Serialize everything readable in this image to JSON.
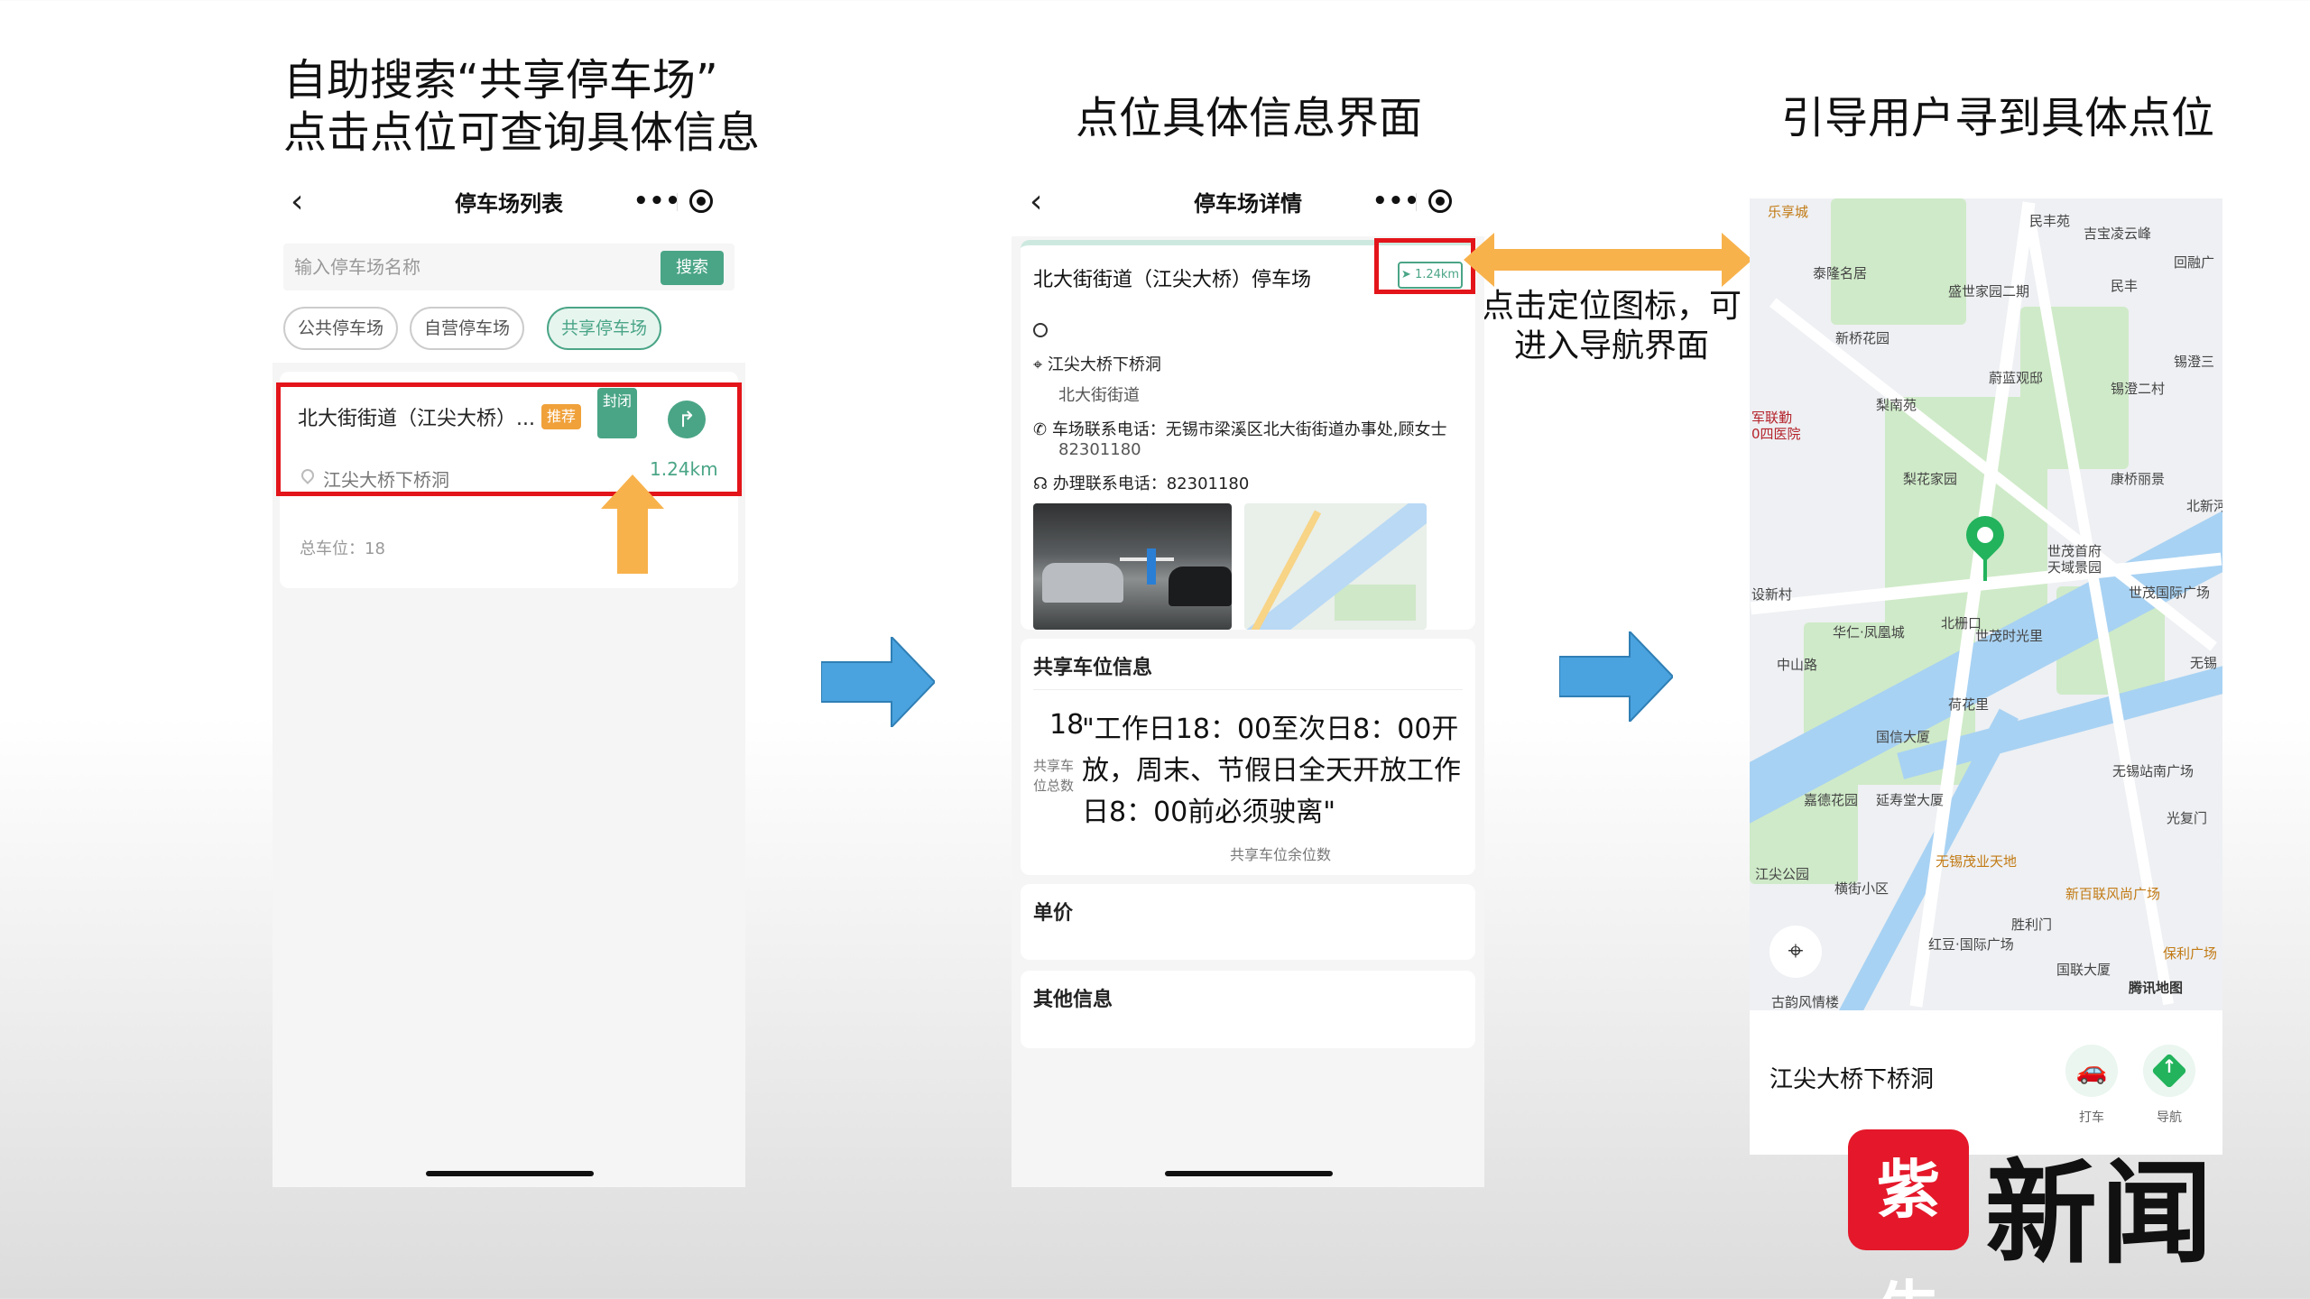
{
  "captions": {
    "step1_line1": "自助搜索“共享停车场”",
    "step1_line2": "点击点位可查询具体信息",
    "step2": "点位具体信息界面",
    "step3": "引导用户寻到具体点位",
    "nav_note": "点击定位图标，可进入导航界面"
  },
  "screen1": {
    "title": "停车场列表",
    "back_icon": "chevron-left-icon",
    "menu_dots": "•••",
    "search_placeholder": "输入停车场名称",
    "search_button": "搜索",
    "filters": [
      "公共停车场",
      "自营停车场",
      "共享停车场"
    ],
    "active_filter": "共享停车场",
    "lot": {
      "name": "北大街街道（江尖大桥）...",
      "badge_recommended": "推荐",
      "badge_closed": "封闭",
      "distance": "1.24km",
      "address": "江尖大桥下桥洞",
      "total_spaces": "总车位：18"
    }
  },
  "screen2": {
    "title": "停车场详情",
    "menu_dots": "•••",
    "lot_name": "北大街街道（江尖大桥）停车场",
    "nav_distance": "1.24km",
    "address": "江尖大桥下桥洞",
    "district": "北大街街道",
    "contact": "车场联系电话：无锡市梁溪区北大街街道办事处,顾女士",
    "contact_phone": "82301180",
    "office_phone": "办理联系电话：82301180",
    "share_section": "共享车位信息",
    "share_count": "18",
    "share_schedule": "\"工作日18：00至次日8：00开放，周末、节假日全天开放工作日8：00前必须驶离\"",
    "share_total_label": "共享车位总数",
    "share_remaining_label": "共享车位余位数",
    "price_section": "单价",
    "other_section": "其他信息"
  },
  "screen3": {
    "destination": "江尖大桥下桥洞",
    "taxi_label": "打车",
    "navigate_label": "导航",
    "map_brand": "腾讯地图",
    "map_labels": [
      "乐享城",
      "民丰苑",
      "吉宝凌云峰",
      "泰隆名居",
      "盛世家园二期",
      "民丰",
      "回融广",
      "新桥花园",
      "锡澄三",
      "蔚蓝观邸",
      "锡澄二村",
      "梨南苑",
      "军联勤",
      "0四医院",
      "梨花家园",
      "康桥丽景",
      "北新河",
      "世茂首府",
      "天域景园",
      "设新村",
      "世茂国际广场",
      "华仁·凤凰城",
      "北栅口",
      "世茂时光里",
      "中山路",
      "荷花里",
      "国信大厦",
      "无锡",
      "嘉德花园",
      "延寿堂大厦",
      "无锡站南广场",
      "光复门",
      "江尖公园",
      "无锡茂业天地",
      "横街小区",
      "新百联风尚广场",
      "胜利门",
      "红豆·国际广场",
      "保利广场",
      "国联大厦",
      "古韵风情楼"
    ]
  },
  "watermark": {
    "logo_text": "紫牛",
    "brand_text": "新闻"
  },
  "colors": {
    "accent_green": "#4aa587",
    "highlight_red": "#e3151a",
    "arrow_orange": "#f8b24c",
    "arrow_blue": "#4aa3df",
    "map_pin_green": "#22b35c"
  }
}
